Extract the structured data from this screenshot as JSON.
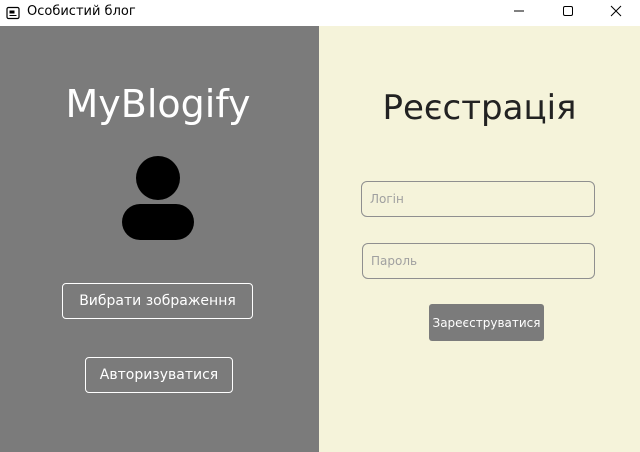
{
  "window": {
    "title": "Особистий блог",
    "icons": {
      "app": "app-window-icon",
      "minimize": "minimize-icon",
      "maximize": "maximize-icon",
      "close": "close-icon"
    }
  },
  "left_panel": {
    "brand": "MyBlogify",
    "avatar_icon": "user-avatar-icon",
    "choose_image_label": "Вибрати зображення",
    "login_label": "Авторизуватися",
    "background": "#7b7b7b"
  },
  "right_panel": {
    "title": "Реєстрація",
    "login_field": {
      "value": "",
      "placeholder": "Логін"
    },
    "password_field": {
      "value": "",
      "placeholder": "Пароль"
    },
    "register_label": "Зареєструватися",
    "background": "#f5f3da"
  }
}
